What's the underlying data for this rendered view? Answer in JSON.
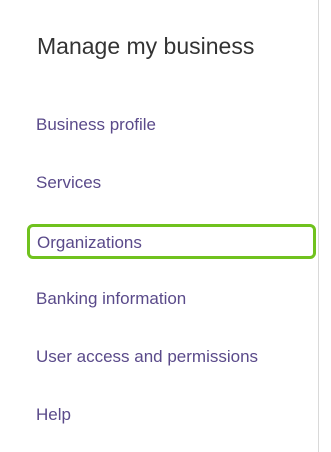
{
  "panel": {
    "title": "Manage my business",
    "items": [
      {
        "label": "Business profile"
      },
      {
        "label": "Services"
      },
      {
        "label": "Organizations",
        "highlighted": true
      },
      {
        "label": "Banking information"
      },
      {
        "label": "User access and permissions"
      },
      {
        "label": "Help"
      }
    ],
    "colors": {
      "link": "#5a4a8a",
      "title": "#333333",
      "highlight_border": "#70c21e",
      "divider": "#d9d9d9"
    }
  }
}
